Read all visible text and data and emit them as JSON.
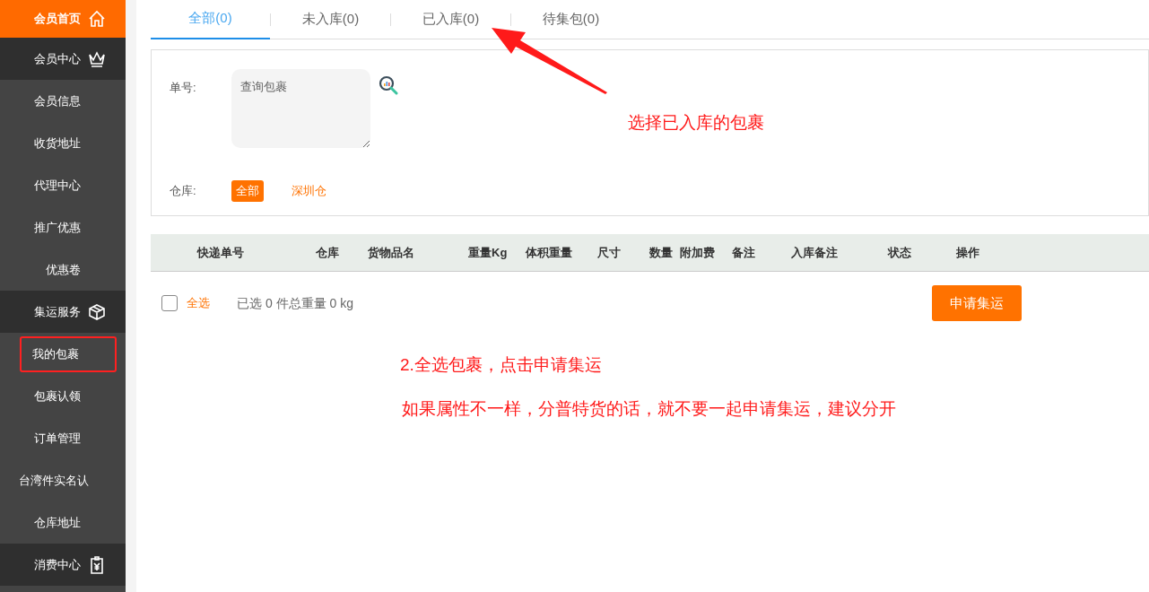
{
  "sidebar": {
    "items": [
      {
        "label": "会员首页",
        "kind": "home",
        "selected": true,
        "highlighted": false
      },
      {
        "label": "会员中心",
        "kind": "section",
        "selected": false,
        "highlighted": false
      },
      {
        "label": "会员信息",
        "kind": "item",
        "selected": false,
        "highlighted": false
      },
      {
        "label": "收货地址",
        "kind": "item",
        "selected": false,
        "highlighted": false
      },
      {
        "label": "代理中心",
        "kind": "item",
        "selected": false,
        "highlighted": false
      },
      {
        "label": "推广优惠",
        "kind": "item",
        "selected": false,
        "highlighted": false
      },
      {
        "label": "优惠卷",
        "kind": "item",
        "selected": false,
        "highlighted": false
      },
      {
        "label": "集运服务",
        "kind": "section",
        "selected": false,
        "highlighted": false
      },
      {
        "label": "我的包裹",
        "kind": "item",
        "selected": false,
        "highlighted": true
      },
      {
        "label": "包裹认领",
        "kind": "item",
        "selected": false,
        "highlighted": false
      },
      {
        "label": "订单管理",
        "kind": "item",
        "selected": false,
        "highlighted": false
      },
      {
        "label": "台湾件实名认",
        "kind": "item",
        "selected": false,
        "highlighted": false
      },
      {
        "label": "仓库地址",
        "kind": "item",
        "selected": false,
        "highlighted": false
      },
      {
        "label": "消费中心",
        "kind": "section",
        "selected": false,
        "highlighted": false
      }
    ]
  },
  "tabs": [
    {
      "label": "全部(0)",
      "selected": true
    },
    {
      "label": "未入库(0)",
      "selected": false
    },
    {
      "label": "已入库(0)",
      "selected": false
    },
    {
      "label": "待集包(0)",
      "selected": false
    }
  ],
  "filter": {
    "number_label": "单号:",
    "search": {
      "placeholder": "查询包裹"
    },
    "warehouse_label": "仓库:",
    "warehouses": [
      {
        "label": "全部",
        "selected": true
      },
      {
        "label": "深圳仓",
        "selected": false
      }
    ]
  },
  "table": {
    "columns": [
      "快递单号",
      "仓库",
      "货物品名",
      "重量Kg",
      "体积重量",
      "尺寸",
      "数量",
      "附加费",
      "备注",
      "入库备注",
      "状态",
      "操作"
    ]
  },
  "footer": {
    "select_all": {
      "label": "全选",
      "checked": false
    },
    "summary": "已选 0 件总重量 0 kg",
    "apply_button": "申请集运"
  },
  "annotations": [
    "选择已入库的包裹",
    "2.全选包裹，点击申请集运",
    "如果属性不一样，分普特货的话，就不要一起申请集运，建议分开"
  ]
}
